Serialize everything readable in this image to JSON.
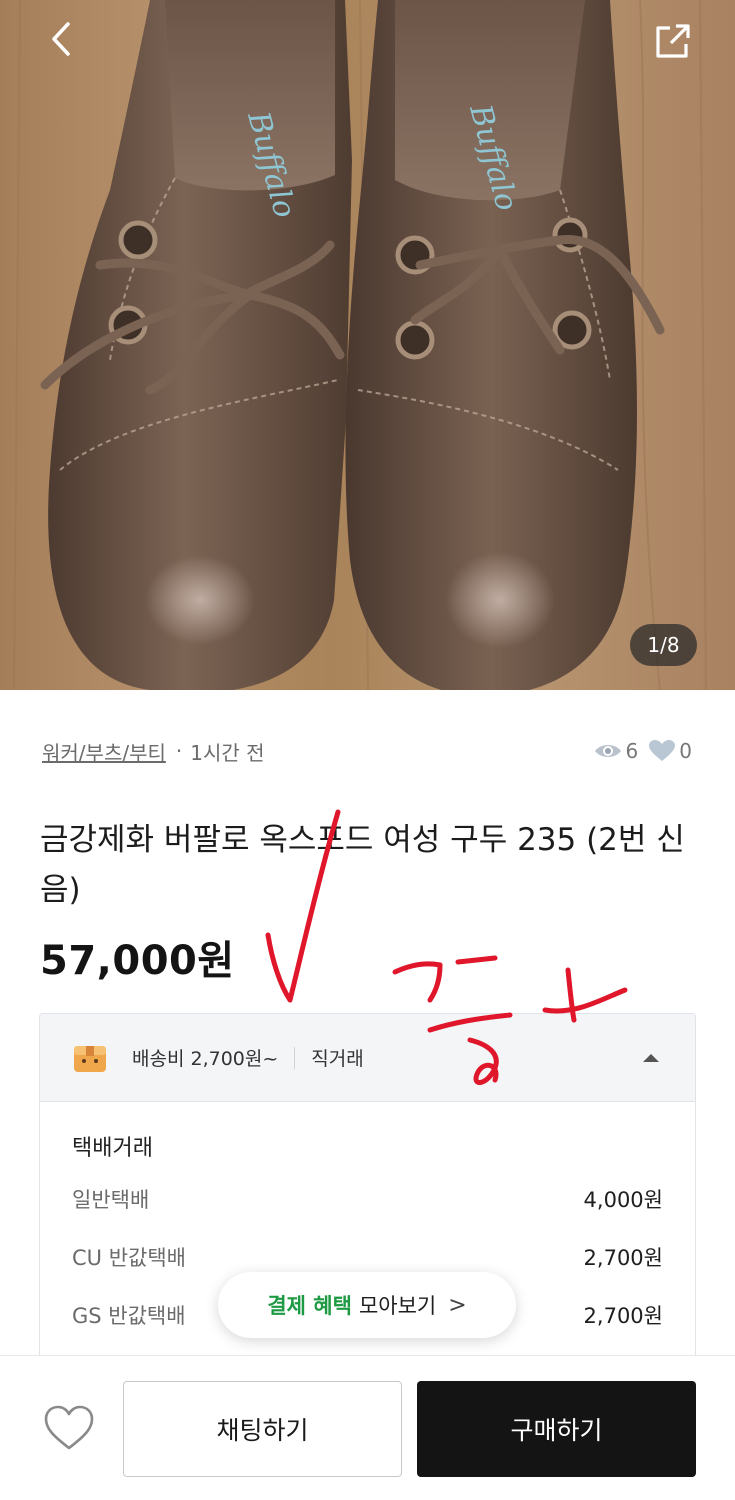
{
  "photo": {
    "counter": "1/8",
    "brand_text": "Buffalo"
  },
  "meta": {
    "category": "워커/부츠/부티",
    "separator": "·",
    "time": "1시간 전",
    "views": "6",
    "likes": "0"
  },
  "product": {
    "title": "금강제화 버팔로 옥스포드 여성 구두 235 (2번 신음)",
    "price": "57,000원"
  },
  "shipping": {
    "fee_label": "배송비 2,700원~",
    "direct_label": "직거래",
    "section_title": "택배거래",
    "options": [
      {
        "name": "일반택배",
        "fee": "4,000원"
      },
      {
        "name": "CU 반값택배",
        "fee": "2,700원"
      },
      {
        "name": "GS 반값택배",
        "fee": "2,700원"
      }
    ]
  },
  "promo": {
    "highlight": "결제 혜택",
    "text": "모아보기",
    "chevron": ">"
  },
  "actions": {
    "chat_label": "채팅하기",
    "buy_label": "구매하기"
  },
  "icons": {
    "back": "chevron-left-icon",
    "share": "share-external-icon",
    "views": "eye-icon",
    "likes": "heart-icon",
    "shipping": "box-icon",
    "wishlist": "heart-outline-icon"
  },
  "colors": {
    "promo_green": "#1f9a44",
    "buy_button": "#141414",
    "annotation_red": "#e0162b"
  }
}
